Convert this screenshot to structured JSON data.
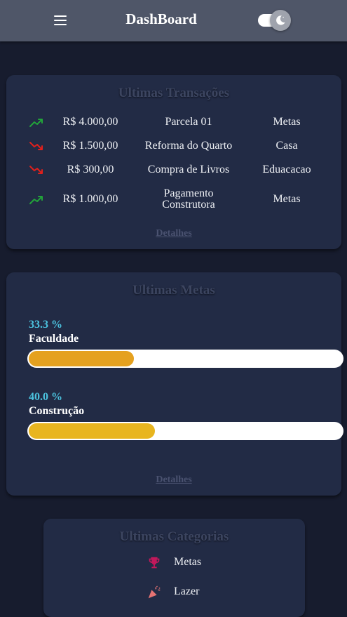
{
  "header": {
    "title": "DashBoard",
    "menu_icon": "hamburger-menu-icon",
    "theme_icon": "moon-icon"
  },
  "transactions": {
    "title": "Ultimas Transações",
    "details_label": "Detalhes",
    "rows": [
      {
        "trend": "up",
        "amount": "R$ 4.000,00",
        "description": "Parcela 01",
        "category": "Metas"
      },
      {
        "trend": "down",
        "amount": "R$ 1.500,00",
        "description": "Reforma do Quarto",
        "category": "Casa"
      },
      {
        "trend": "down",
        "amount": "R$ 300,00",
        "description": "Compra de Livros",
        "category": "Eduacacao"
      },
      {
        "trend": "up",
        "amount": "R$ 1.000,00",
        "description": "Pagamento Construtora",
        "category": "Metas"
      }
    ]
  },
  "goals": {
    "title": "Ultimas Metas",
    "details_label": "Detalhes",
    "items": [
      {
        "percent_label": "33.3 %",
        "name": "Faculdade",
        "progress": 0.333,
        "color": "#e5a11f"
      },
      {
        "percent_label": "40.0 %",
        "name": "Construção",
        "progress": 0.4,
        "color": "#e8b51f"
      }
    ]
  },
  "categories": {
    "title": "Ultimas Categorias",
    "items": [
      {
        "icon": "trophy-icon",
        "label": "Metas",
        "color": "#c2185b"
      },
      {
        "icon": "party-popper-icon",
        "label": "Lazer",
        "color": "#e57373"
      }
    ]
  },
  "colors": {
    "up": "#22a33a",
    "down": "#e0201c",
    "background": "#171c2e",
    "card": "#222b45",
    "header": "#4f5668"
  }
}
